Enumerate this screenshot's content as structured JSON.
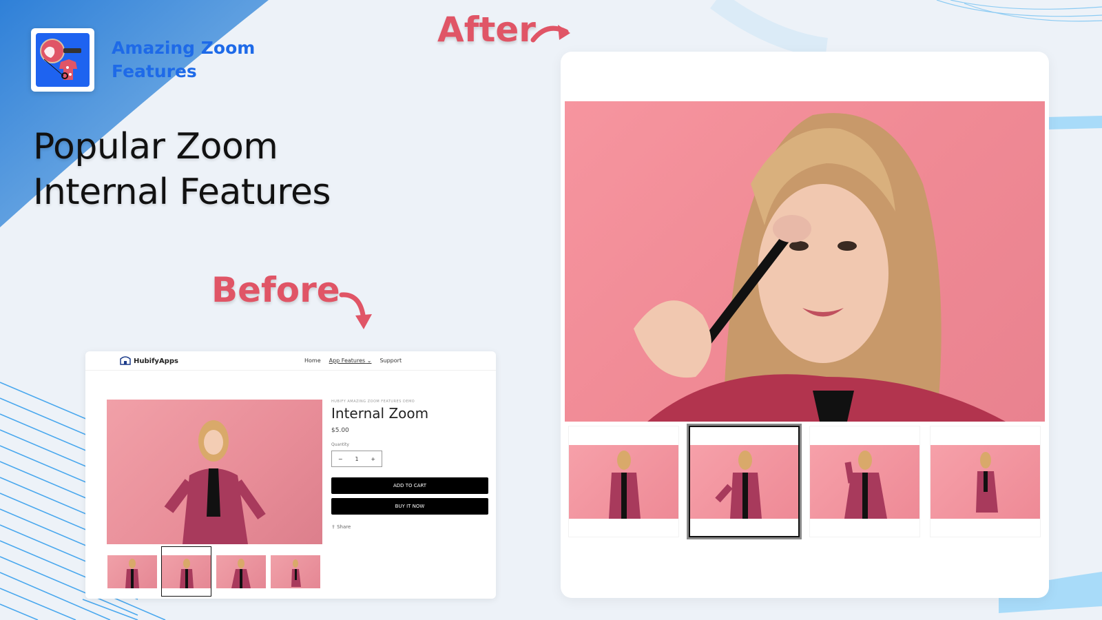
{
  "brand": {
    "name_line1": "Amazing Zoom",
    "name_line2": "Features",
    "logo_icon": "magnifier-shirt-icon",
    "color": "#1e6ae8"
  },
  "hero": {
    "line1": "Popular Zoom",
    "line2": "Internal Features"
  },
  "labels": {
    "after": "After",
    "before": "Before",
    "accent_color": "#e05566"
  },
  "before_store": {
    "logo_text": "HubifyApps",
    "nav": [
      {
        "label": "Home"
      },
      {
        "label": "App Features",
        "has_dropdown": true
      },
      {
        "label": "Support"
      }
    ],
    "product": {
      "vendor": "HUBIFY AMAZING ZOOM FEATURES DEMO",
      "title": "Internal Zoom",
      "price": "$5.00",
      "quantity_label": "Quantity",
      "quantity_value": "1",
      "minus": "−",
      "plus": "+",
      "add_to_cart": "ADD TO CART",
      "buy_now": "BUY IT NOW",
      "share": "Share"
    },
    "thumbnails": [
      {
        "alt": "woman-blowing-kiss",
        "active": false
      },
      {
        "alt": "woman-makeup-brush",
        "active": true
      },
      {
        "alt": "woman-hand-on-hip",
        "active": false
      },
      {
        "alt": "woman-side-pose",
        "active": false
      }
    ]
  },
  "after_store": {
    "main_image": "woman-makeup-brush-zoomed",
    "thumbnails": [
      {
        "alt": "woman-blowing-kiss",
        "active": false
      },
      {
        "alt": "woman-makeup-brush",
        "active": true
      },
      {
        "alt": "woman-hand-on-hip",
        "active": false
      },
      {
        "alt": "woman-side-pose",
        "active": false
      }
    ]
  }
}
